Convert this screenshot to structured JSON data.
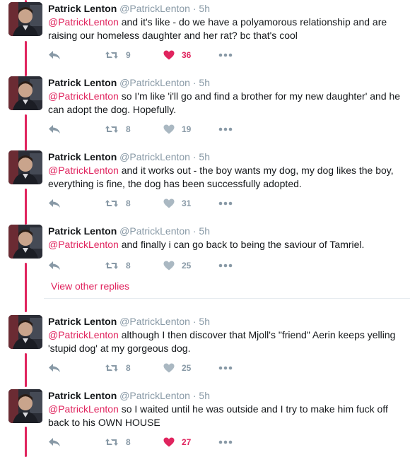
{
  "theme": {
    "accent": "#e0245e",
    "muted": "#8899a6",
    "divider": "#e6ecf0"
  },
  "tweets": [
    {
      "name": "Patrick Lenton",
      "handle": "@PatrickLenton",
      "dot": "·",
      "time": "5h",
      "mention": "@PatrickLenton",
      "body": "and it's like - do we have a polyamorous relationship and are raising our homeless daughter and her rat? bc that's cool",
      "retweets": "9",
      "likes": "36",
      "liked": true
    },
    {
      "name": "Patrick Lenton",
      "handle": "@PatrickLenton",
      "dot": "·",
      "time": "5h",
      "mention": "@PatrickLenton",
      "body": "so I'm like 'i'll go and find a brother for my new daughter' and he can adopt the dog. Hopefully.",
      "retweets": "8",
      "likes": "19",
      "liked": false
    },
    {
      "name": "Patrick Lenton",
      "handle": "@PatrickLenton",
      "dot": "·",
      "time": "5h",
      "mention": "@PatrickLenton",
      "body": "and it works out - the boy wants my dog, my dog likes the boy, everything is fine, the dog has been successfully adopted.",
      "retweets": "8",
      "likes": "31",
      "liked": false
    },
    {
      "name": "Patrick Lenton",
      "handle": "@PatrickLenton",
      "dot": "·",
      "time": "5h",
      "mention": "@PatrickLenton",
      "body": "and finally i can go back to being the saviour of Tamriel.",
      "retweets": "8",
      "likes": "25",
      "liked": false
    },
    {
      "name": "Patrick Lenton",
      "handle": "@PatrickLenton",
      "dot": "·",
      "time": "5h",
      "mention": "@PatrickLenton",
      "body": "although I then discover that Mjoll's \"friend\" Aerin keeps yelling 'stupid dog' at my gorgeous dog.",
      "retweets": "8",
      "likes": "25",
      "liked": false
    },
    {
      "name": "Patrick Lenton",
      "handle": "@PatrickLenton",
      "dot": "·",
      "time": "5h",
      "mention": "@PatrickLenton",
      "body": "so I waited until he was outside and I try to make him fuck off back to his OWN HOUSE",
      "retweets": "8",
      "likes": "27",
      "liked": true
    }
  ],
  "view_other_replies": "View other replies"
}
